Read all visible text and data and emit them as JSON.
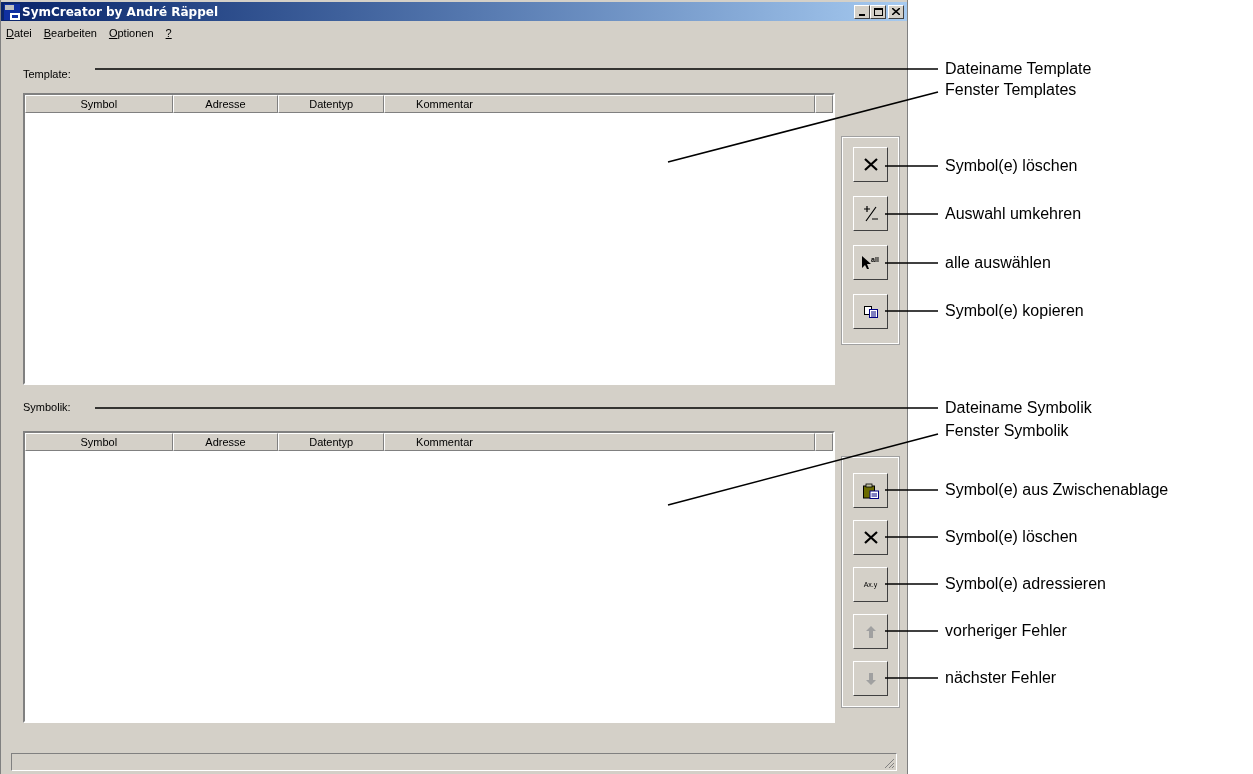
{
  "window": {
    "title": "SymCreator by André Räppel"
  },
  "menu": [
    {
      "mnemonic": "D",
      "rest": "atei"
    },
    {
      "mnemonic": "B",
      "rest": "earbeiten"
    },
    {
      "mnemonic": "O",
      "rest": "ptionen"
    },
    {
      "mnemonic": "?"
    }
  ],
  "sections": [
    {
      "label": "Template:",
      "columns": [
        "Symbol",
        "Adresse",
        "Datentyp",
        "Kommentar"
      ],
      "buttons": [
        {
          "kind": "delete",
          "disabled": false
        },
        {
          "kind": "invert",
          "disabled": false
        },
        {
          "kind": "select_all",
          "icon_text": "all",
          "disabled": false
        },
        {
          "kind": "copy",
          "disabled": false
        }
      ]
    },
    {
      "label": "Symbolik:",
      "columns": [
        "Symbol",
        "Adresse",
        "Datentyp",
        "Kommentar"
      ],
      "buttons": [
        {
          "kind": "paste",
          "disabled": false
        },
        {
          "kind": "delete",
          "disabled": false
        },
        {
          "kind": "address",
          "icon_text": "Ax.y",
          "disabled": false
        },
        {
          "kind": "up",
          "disabled": true
        },
        {
          "kind": "down",
          "disabled": true
        }
      ]
    }
  ],
  "annotations": [
    {
      "text": "Dateiname Template"
    },
    {
      "text": "Fenster Templates"
    },
    {
      "text": "Symbol(e) löschen"
    },
    {
      "text": "Auswahl umkehren"
    },
    {
      "text": "alle auswählen"
    },
    {
      "text": "Symbol(e) kopieren"
    },
    {
      "text": "Dateiname Symbolik"
    },
    {
      "text": "Fenster Symbolik"
    },
    {
      "text": "Symbol(e) aus Zwischenablage"
    },
    {
      "text": "Symbol(e) löschen"
    },
    {
      "text": "Symbol(e) adressieren"
    },
    {
      "text": "vorheriger Fehler"
    },
    {
      "text": "nächster Fehler"
    }
  ]
}
